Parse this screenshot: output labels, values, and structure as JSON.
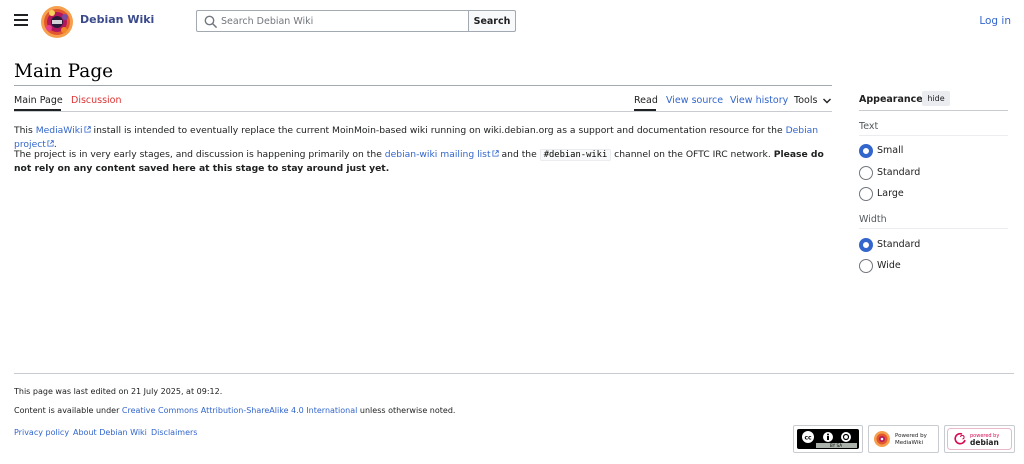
{
  "header": {
    "site_name": "Debian Wiki",
    "search_placeholder": "Search Debian Wiki",
    "search_button": "Search",
    "login": "Log in"
  },
  "page": {
    "title": "Main Page",
    "tabs_left": [
      "Main Page",
      "Discussion"
    ],
    "tabs_right": [
      "Read",
      "View source",
      "View history",
      "Tools"
    ],
    "active_left_tab": "Main Page",
    "active_right_tab": "Read"
  },
  "content": {
    "p1": {
      "t1": "This ",
      "link1": "MediaWiki",
      "t2": " install is intended to eventually replace the current MoinMoin-based wiki running on wiki.debian.org as a support and documentation resource for the ",
      "link2": "Debian project",
      "t3": "."
    },
    "p2": {
      "t1": "The project is in very early stages, and discussion is happening primarily on the ",
      "link1": "debian-wiki mailing list",
      "t2": " and the ",
      "code": "#debian-wiki",
      "t3": " channel on the OFTC IRC network. ",
      "bold": "Please do not rely on any content saved here at this stage to stay around just yet."
    }
  },
  "appearance": {
    "title": "Appearance",
    "hide": "hide",
    "text_label": "Text",
    "text_options": [
      "Small",
      "Standard",
      "Large"
    ],
    "text_selected": "Small",
    "width_label": "Width",
    "width_options": [
      "Standard",
      "Wide"
    ],
    "width_selected": "Standard"
  },
  "footer": {
    "last_edited": "This page was last edited on 21 July 2025, at 09:12.",
    "license_prefix": "Content is available under ",
    "license_link": "Creative Commons Attribution-ShareAlike 4.0 International",
    "license_suffix": " unless otherwise noted.",
    "links": [
      "Privacy policy",
      "About Debian Wiki",
      "Disclaimers"
    ],
    "badges": {
      "cc": "BY SA",
      "mediawiki_top": "Powered by",
      "mediawiki_bottom": "MediaWiki",
      "debian_top": "powered by",
      "debian_bottom": "debian"
    }
  },
  "colors": {
    "link": "#3366cc",
    "discussion_red": "#dd3333",
    "accent_blue": "#3366cc",
    "debian_red": "#d70a53"
  },
  "icons": [
    "menu-icon",
    "search-icon",
    "external-link-icon",
    "chevron-down-icon"
  ]
}
